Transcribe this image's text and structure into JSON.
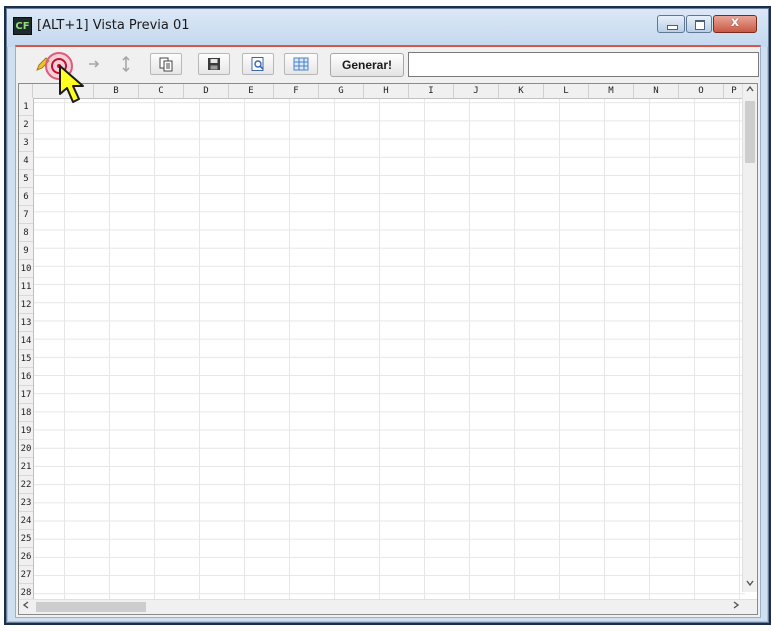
{
  "window": {
    "app_icon_text": "CF",
    "title": "[ALT+1] Vista Previa 01",
    "minimize_icon": "minimize-icon",
    "maximize_icon": "maximize-icon",
    "close_icon": "close-icon",
    "close_glyph": "x"
  },
  "toolbar": {
    "generate_label": "Generar!",
    "input_value": "",
    "icons": [
      "pencil-icon",
      "arrow-right-icon",
      "sort-vertical-icon",
      "copy-icon",
      "save-icon",
      "preview-icon",
      "table-icon"
    ]
  },
  "grid": {
    "columns": [
      "",
      "B",
      "C",
      "D",
      "E",
      "F",
      "G",
      "H",
      "I",
      "J",
      "K",
      "L",
      "M",
      "N",
      "O",
      "P"
    ],
    "rows": [
      "1",
      "2",
      "3",
      "4",
      "5",
      "6",
      "7",
      "8",
      "9",
      "10",
      "11",
      "12",
      "13",
      "14",
      "15",
      "16",
      "17",
      "18",
      "19",
      "20",
      "21",
      "22",
      "23",
      "24",
      "25",
      "26",
      "27",
      "28"
    ]
  },
  "colors": {
    "accent_red": "#d7564c",
    "title_bg": "#cfe0f1",
    "cursor_yellow": "#ffff20"
  }
}
